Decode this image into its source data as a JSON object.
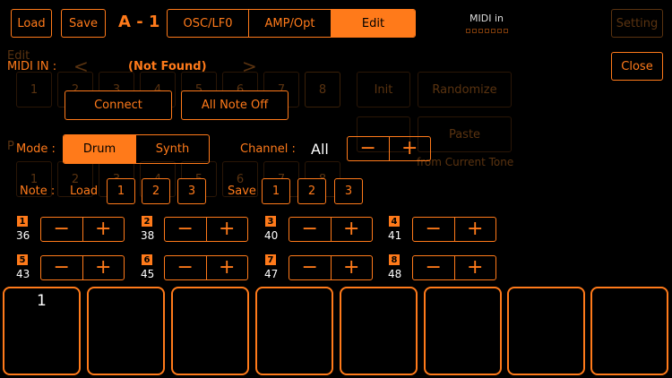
{
  "header": {
    "load_label": "Load",
    "save_label": "Save",
    "preset_name": "A - 1",
    "tabs": [
      {
        "label": "OSC/LF0",
        "active": false
      },
      {
        "label": "AMP/Opt",
        "active": false
      },
      {
        "label": "Edit",
        "active": true
      }
    ],
    "midi_in_indicator": "MIDI in",
    "setting_label": "Setting",
    "close_label": "Close"
  },
  "background": {
    "edit_label": "Edit",
    "edit_slots": [
      "1",
      "2",
      "3",
      "4",
      "5",
      "6",
      "7",
      "8"
    ],
    "init_label": "Init",
    "randomize_label": "Randomize",
    "paste_label": "Paste",
    "paste_subtext": "from Current Tone",
    "p_label": "P",
    "p_slots": [
      "1",
      "2",
      "3",
      "4",
      "5",
      "6",
      "7",
      "8"
    ]
  },
  "midi": {
    "midi_in_label": "MIDI IN :",
    "status": "(Not Found)",
    "connect_label": "Connect",
    "all_note_off_label": "All Note Off",
    "mode_label": "Mode :",
    "mode_options": [
      {
        "label": "Drum",
        "active": true
      },
      {
        "label": "Synth",
        "active": false
      }
    ],
    "channel_label": "Channel :",
    "channel_value": "All",
    "minus": "−",
    "plus": "+"
  },
  "note_row": {
    "note_label": "Note :",
    "load_label": "Load",
    "load_slots": [
      "1",
      "2",
      "3"
    ],
    "save_label": "Save",
    "save_slots": [
      "1",
      "2",
      "3"
    ]
  },
  "notes": [
    {
      "index": "1",
      "value": "36"
    },
    {
      "index": "2",
      "value": "38"
    },
    {
      "index": "3",
      "value": "40"
    },
    {
      "index": "4",
      "value": "41"
    },
    {
      "index": "5",
      "value": "43"
    },
    {
      "index": "6",
      "value": "45"
    },
    {
      "index": "7",
      "value": "47"
    },
    {
      "index": "8",
      "value": "48"
    }
  ],
  "pads": [
    {
      "label": "1"
    },
    {
      "label": ""
    },
    {
      "label": ""
    },
    {
      "label": ""
    },
    {
      "label": ""
    },
    {
      "label": ""
    },
    {
      "label": ""
    },
    {
      "label": ""
    }
  ],
  "colors": {
    "accent": "#ff7a1a",
    "background": "#000000"
  }
}
